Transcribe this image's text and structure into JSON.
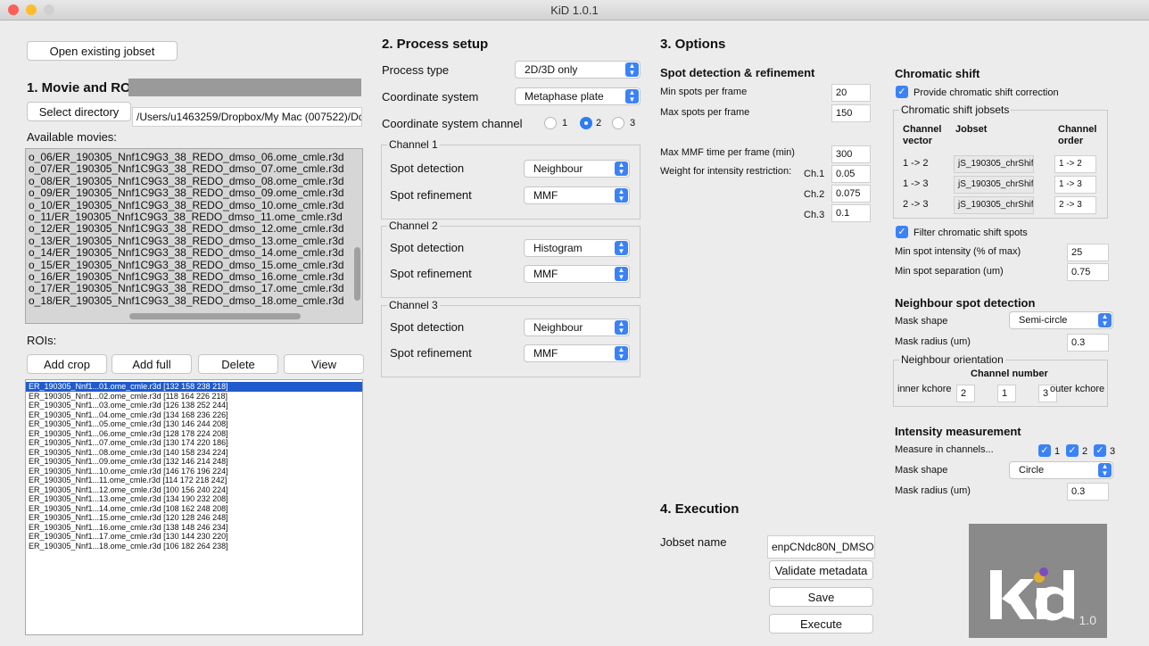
{
  "window": {
    "title": "KiD 1.0.1"
  },
  "left": {
    "open_jobset": "Open existing jobset",
    "section_title": "1. Movie and ROI",
    "select_directory": "Select directory",
    "directory_path": "/Users/u1463259/Dropbox/My Mac (007522)/Dc",
    "available_movies_label": "Available movies:",
    "movies": [
      "o_06/ER_190305_Nnf1C9G3_38_REDO_dmso_06.ome_cmle.r3d",
      "o_07/ER_190305_Nnf1C9G3_38_REDO_dmso_07.ome_cmle.r3d",
      "o_08/ER_190305_Nnf1C9G3_38_REDO_dmso_08.ome_cmle.r3d",
      "o_09/ER_190305_Nnf1C9G3_38_REDO_dmso_09.ome_cmle.r3d",
      "o_10/ER_190305_Nnf1C9G3_38_REDO_dmso_10.ome_cmle.r3d",
      "o_11/ER_190305_Nnf1C9G3_38_REDO_dmso_11.ome_cmle.r3d",
      "o_12/ER_190305_Nnf1C9G3_38_REDO_dmso_12.ome_cmle.r3d",
      "o_13/ER_190305_Nnf1C9G3_38_REDO_dmso_13.ome_cmle.r3d",
      "o_14/ER_190305_Nnf1C9G3_38_REDO_dmso_14.ome_cmle.r3d",
      "o_15/ER_190305_Nnf1C9G3_38_REDO_dmso_15.ome_cmle.r3d",
      "o_16/ER_190305_Nnf1C9G3_38_REDO_dmso_16.ome_cmle.r3d",
      "o_17/ER_190305_Nnf1C9G3_38_REDO_dmso_17.ome_cmle.r3d",
      "o_18/ER_190305_Nnf1C9G3_38_REDO_dmso_18.ome_cmle.r3d"
    ],
    "rois_label": "ROIs:",
    "roi_buttons": [
      "Add crop",
      "Add full",
      "Delete",
      "View"
    ],
    "rois": [
      "ER_190305_Nnf1...01.ome_cmle.r3d [132 158 238 218]",
      "ER_190305_Nnf1...02.ome_cmle.r3d [118 164 226 218]",
      "ER_190305_Nnf1...03.ome_cmle.r3d [126 138 252 244]",
      "ER_190305_Nnf1...04.ome_cmle.r3d [134 168 236 226]",
      "ER_190305_Nnf1...05.ome_cmle.r3d [130 146 244 208]",
      "ER_190305_Nnf1...06.ome_cmle.r3d [128 178 224 208]",
      "ER_190305_Nnf1...07.ome_cmle.r3d [130 174 220 186]",
      "ER_190305_Nnf1...08.ome_cmle.r3d [140 158 234 224]",
      "ER_190305_Nnf1...09.ome_cmle.r3d [132 146 214 248]",
      "ER_190305_Nnf1...10.ome_cmle.r3d [146 176 196 224]",
      "ER_190305_Nnf1...11.ome_cmle.r3d [114 172 218 242]",
      "ER_190305_Nnf1...12.ome_cmle.r3d [100 156 240 224]",
      "ER_190305_Nnf1...13.ome_cmle.r3d [134 190 232 208]",
      "ER_190305_Nnf1...14.ome_cmle.r3d [108 162 248 208]",
      "ER_190305_Nnf1...15.ome_cmle.r3d [120 128 246 248]",
      "ER_190305_Nnf1...16.ome_cmle.r3d [138 148 246 234]",
      "ER_190305_Nnf1...17.ome_cmle.r3d [130 144 230 220]",
      "ER_190305_Nnf1...18.ome_cmle.r3d [106 182 264 238]"
    ]
  },
  "process": {
    "title": "2. Process setup",
    "process_type_label": "Process type",
    "process_type_value": "2D/3D only",
    "coord_system_label": "Coordinate system",
    "coord_system_value": "Metaphase plate",
    "coord_channel_label": "Coordinate system channel",
    "coord_channel_options": [
      "1",
      "2",
      "3"
    ],
    "channels": [
      {
        "title": "Channel 1",
        "detection_label": "Spot detection",
        "detection_value": "Neighbour",
        "refinement_label": "Spot refinement",
        "refinement_value": "MMF"
      },
      {
        "title": "Channel 2",
        "detection_label": "Spot detection",
        "detection_value": "Histogram",
        "refinement_label": "Spot refinement",
        "refinement_value": "MMF"
      },
      {
        "title": "Channel 3",
        "detection_label": "Spot detection",
        "detection_value": "Neighbour",
        "refinement_label": "Spot refinement",
        "refinement_value": "MMF"
      }
    ]
  },
  "options": {
    "title": "3. Options",
    "spot_title": "Spot detection & refinement",
    "min_spots_label": "Min spots per frame",
    "min_spots_value": "20",
    "max_spots_label": "Max spots per frame",
    "max_spots_value": "150",
    "max_mmf_label": "Max MMF time per frame (min)",
    "max_mmf_value": "300",
    "weight_label": "Weight for intensity restriction:",
    "weights": [
      {
        "ch": "Ch.1",
        "value": "0.05"
      },
      {
        "ch": "Ch.2",
        "value": "0.075"
      },
      {
        "ch": "Ch.3",
        "value": "0.1"
      }
    ],
    "chromatic_title": "Chromatic shift",
    "provide_correction": "Provide chromatic shift correction",
    "jobsets_legend": "Chromatic shift jobsets",
    "col_vector": "Channel vector",
    "col_jobset": "Jobset",
    "col_order": "Channel order",
    "chrom_rows": [
      {
        "vector": "1  ->  2",
        "jobset": "jS_190305_chrShif...",
        "from": "1",
        "to": "2"
      },
      {
        "vector": "1  ->  3",
        "jobset": "jS_190305_chrShif...",
        "from": "1",
        "to": "3"
      },
      {
        "vector": "2  ->  3",
        "jobset": "jS_190305_chrShif...",
        "from": "2",
        "to": "3"
      }
    ],
    "order_arrow": "->",
    "filter_label": "Filter chromatic shift spots",
    "min_intensity_label": "Min spot intensity (% of max)",
    "min_intensity_value": "25",
    "min_separation_label": "Min spot separation (um)",
    "min_separation_value": "0.75",
    "neighbour_title": "Neighbour spot detection",
    "mask_shape_label": "Mask shape",
    "mask_shape_value": "Semi-circle",
    "mask_radius_label": "Mask radius (um)",
    "mask_radius_value": "0.3",
    "orientation_legend": "Neighbour orientation",
    "channel_number_label": "Channel number",
    "inner_label": "inner kchore",
    "outer_label": "outer kchore",
    "orientation_values": [
      "2",
      "1",
      "3"
    ],
    "intensity_title": "Intensity measurement",
    "measure_label": "Measure in channels...",
    "measure_channels": [
      "1",
      "2",
      "3"
    ],
    "int_mask_shape_label": "Mask shape",
    "int_mask_shape_value": "Circle",
    "int_mask_radius_label": "Mask radius (um)",
    "int_mask_radius_value": "0.3"
  },
  "execution": {
    "title": "4. Execution",
    "jobset_name_label": "Jobset name",
    "jobset_name_value": "enpCNdc80N_DMSO",
    "validate": "Validate metadata",
    "save": "Save",
    "execute": "Execute"
  },
  "logo": {
    "version": "1.0",
    "accent": "#8a8a8a"
  }
}
